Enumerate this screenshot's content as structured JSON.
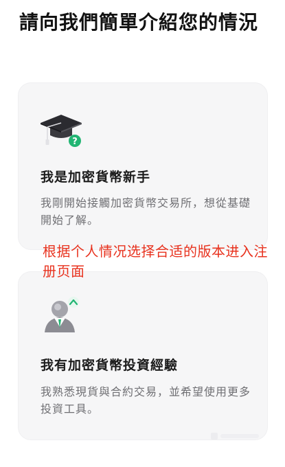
{
  "page": {
    "title": "請向我們簡單介紹您的情況"
  },
  "options": [
    {
      "icon": "graduation-cap-question-icon",
      "heading": "我是加密貨幣新手",
      "description": "我剛開始接觸加密貨幣交易所，想從基礎開始了解。"
    },
    {
      "icon": "experienced-user-upgrade-icon",
      "heading": "我有加密貨幣投資經驗",
      "description": "我熟悉現貨與合約交易，並希望使用更多投資工具。"
    }
  ],
  "annotation": {
    "text": "根据个人情况选择合适的版本进入注册页面",
    "color": "#e8321e"
  },
  "colors": {
    "card_background": "#f6f6f7",
    "badge_green": "#22b573"
  }
}
